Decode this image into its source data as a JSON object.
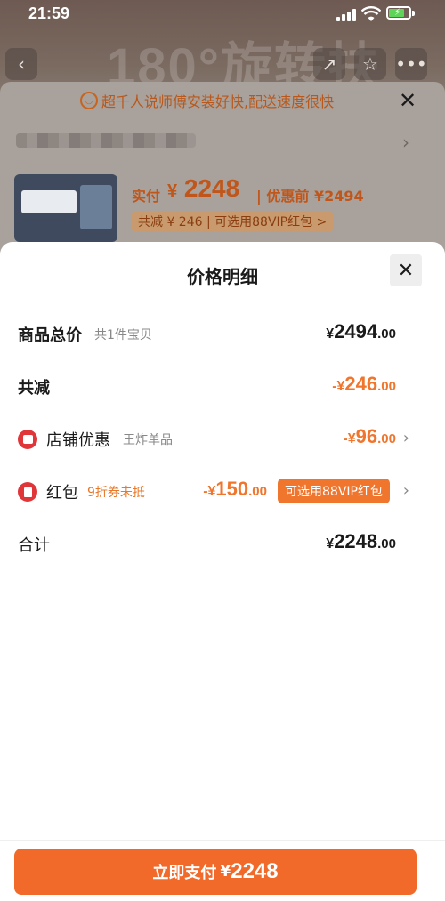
{
  "status_bar": {
    "time": "21:59"
  },
  "background": {
    "banner_text": "180°旋转扶",
    "tip": "超千人说师傅安装好快,配送速度很快",
    "product": {
      "paid_label": "实付",
      "paid_currency": "¥",
      "paid_amount": "2248",
      "original_price": "| 优惠前 ¥2494",
      "badge": "共减 ¥ 246 | 可选用88VIP红包 >"
    }
  },
  "sheet": {
    "title": "价格明细",
    "rows": [
      {
        "label": "商品总价",
        "sub": "共1件宝贝",
        "currency": "¥",
        "integer": "2494",
        "decimal": ".00"
      },
      {
        "label": "共减",
        "sub": "",
        "currency": "-¥",
        "integer": "246",
        "decimal": ".00"
      },
      {
        "label": "店铺优惠",
        "sub": "王炸单品",
        "currency": "-¥",
        "integer": "96",
        "decimal": ".00"
      },
      {
        "label": "红包",
        "sub": "9折券未抵",
        "currency": "-¥",
        "integer": "150",
        "decimal": ".00",
        "badge": "可选用88VIP红包"
      },
      {
        "label": "合计",
        "sub": "",
        "currency": "¥",
        "integer": "2248",
        "decimal": ".00"
      }
    ]
  },
  "pay_button": {
    "label": "立即支付",
    "currency": "¥",
    "amount": "2248"
  },
  "colors": {
    "accent": "#f26a2a",
    "discount": "#f0762e",
    "coupon_icon": "#e0363a"
  },
  "icons": [
    "back-icon",
    "share-icon",
    "star-icon",
    "more-icon",
    "close-icon",
    "chevron-right-icon",
    "shop-coupon-icon",
    "red-packet-icon"
  ]
}
